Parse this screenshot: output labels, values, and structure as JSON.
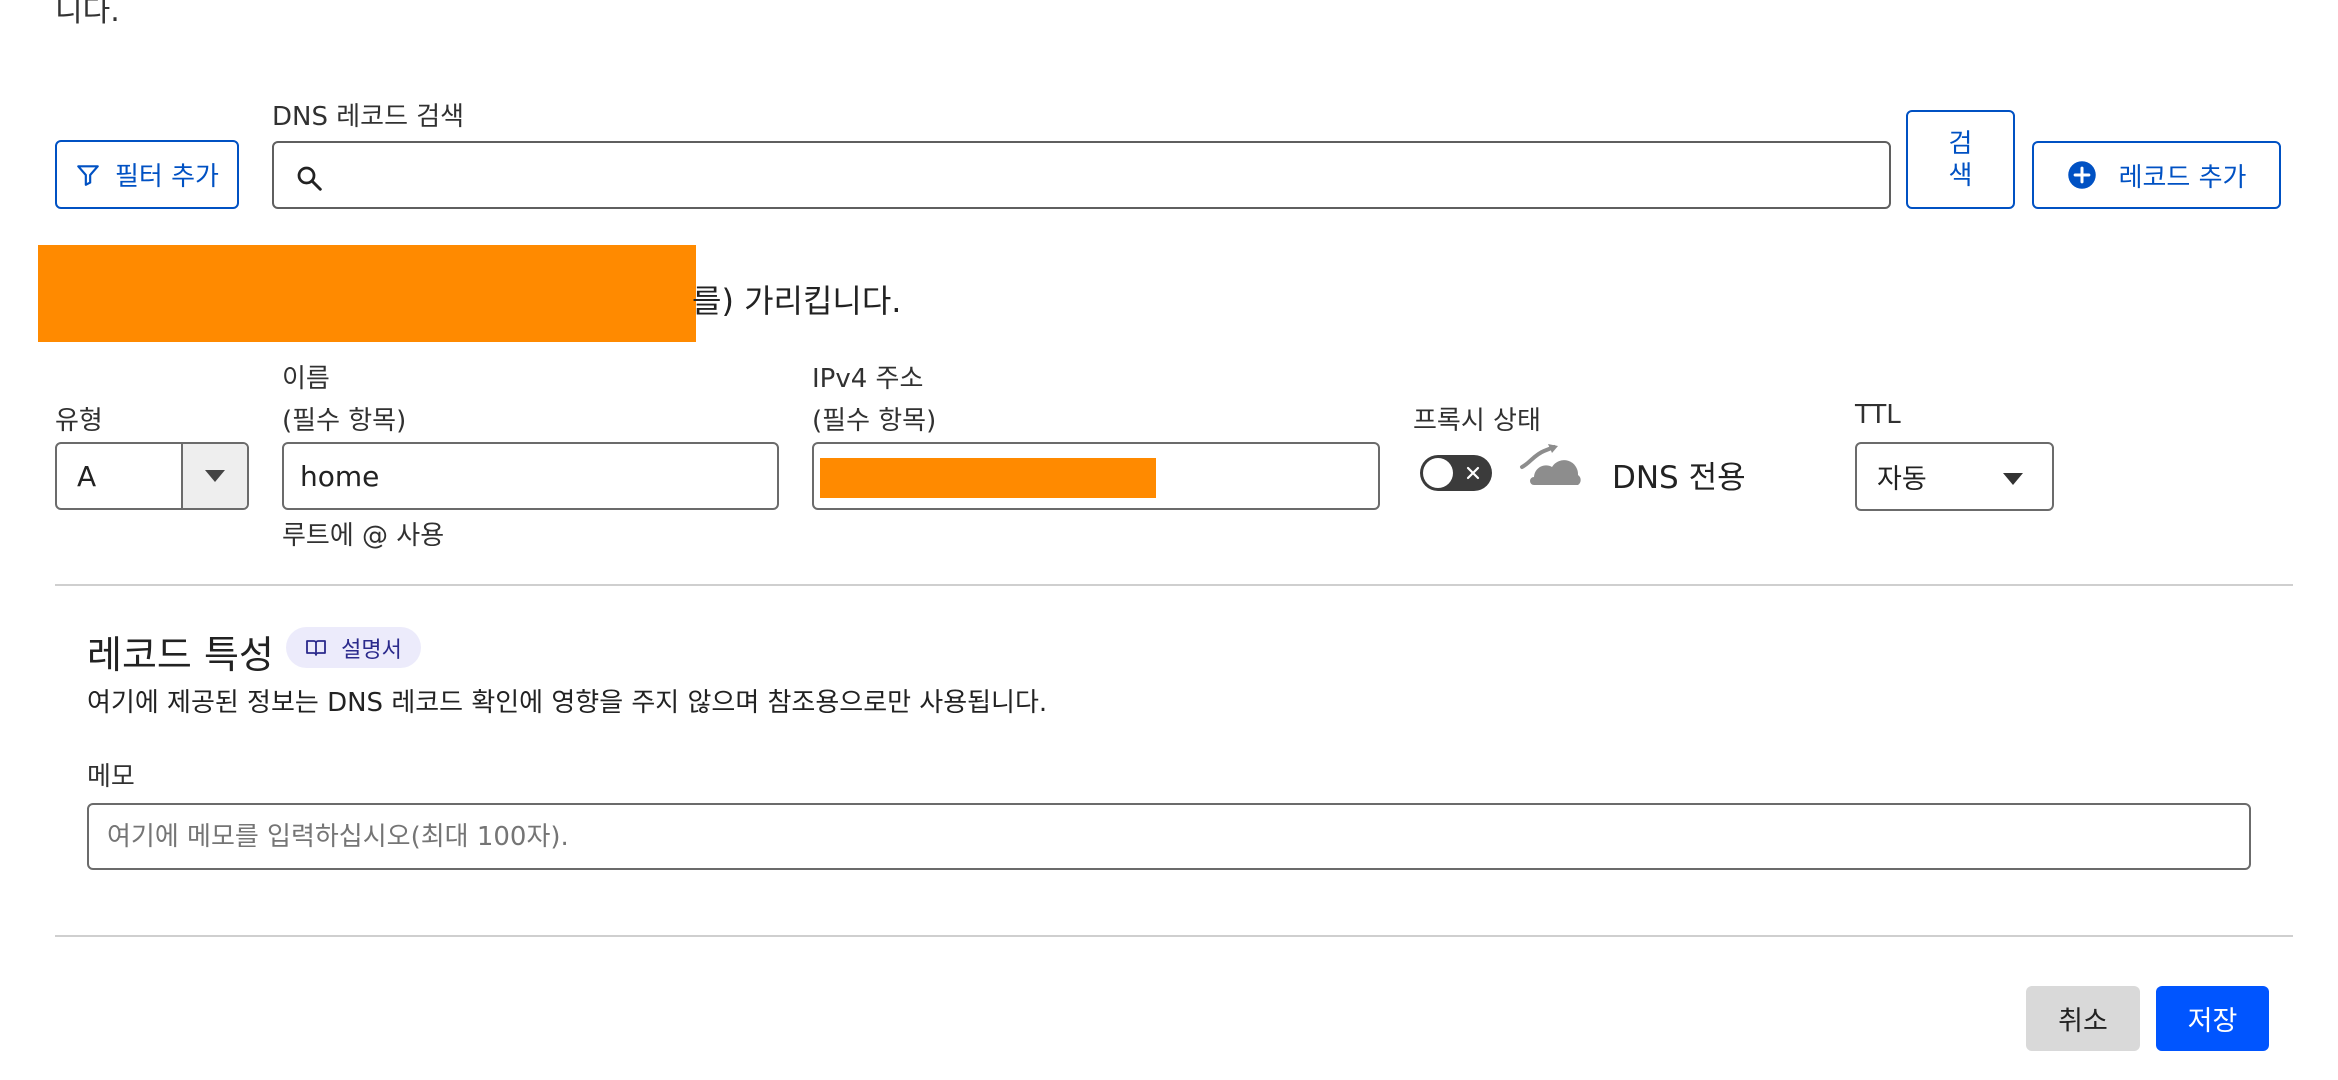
{
  "header": {
    "cut_text": "니다."
  },
  "toolbar": {
    "filter_label": "필터 추가",
    "search_label": "DNS 레코드 검색",
    "search_placeholder": "",
    "search_button_line1": "검",
    "search_button_line2": "색",
    "add_record_label": "레코드 추가"
  },
  "notice": {
    "visible_text": "를) 가리킵니다."
  },
  "record_form": {
    "type": {
      "label": "유형",
      "value": "A"
    },
    "name": {
      "label_line1": "이름",
      "label_line2": "(필수 항목)",
      "value": "home",
      "hint": "루트에 @ 사용"
    },
    "ipv4": {
      "label_line1": "IPv4 주소",
      "label_line2": "(필수 항목)"
    },
    "proxy": {
      "label": "프록시 상태",
      "status_text": "DNS 전용"
    },
    "ttl": {
      "label": "TTL",
      "value": "자동"
    }
  },
  "attributes": {
    "title": "레코드 특성",
    "docs_label": "설명서",
    "description": "여기에 제공된 정보는 DNS 레코드 확인에 영향을 주지 않으며 참조용으로만 사용됩니다.",
    "memo_label": "메모",
    "memo_placeholder": "여기에 메모를 입력하십시오(최대 100자)."
  },
  "footer": {
    "cancel_label": "취소",
    "save_label": "저장"
  },
  "colors": {
    "accent": "#0051c3",
    "redaction": "#ff8a00",
    "save_bg": "#0055ff",
    "cancel_bg": "#d9d9d9"
  },
  "icons": [
    "filter-icon",
    "search-icon",
    "add-circle-icon",
    "chevron-down-icon",
    "toggle-off",
    "cloud-icon",
    "book-icon"
  ]
}
